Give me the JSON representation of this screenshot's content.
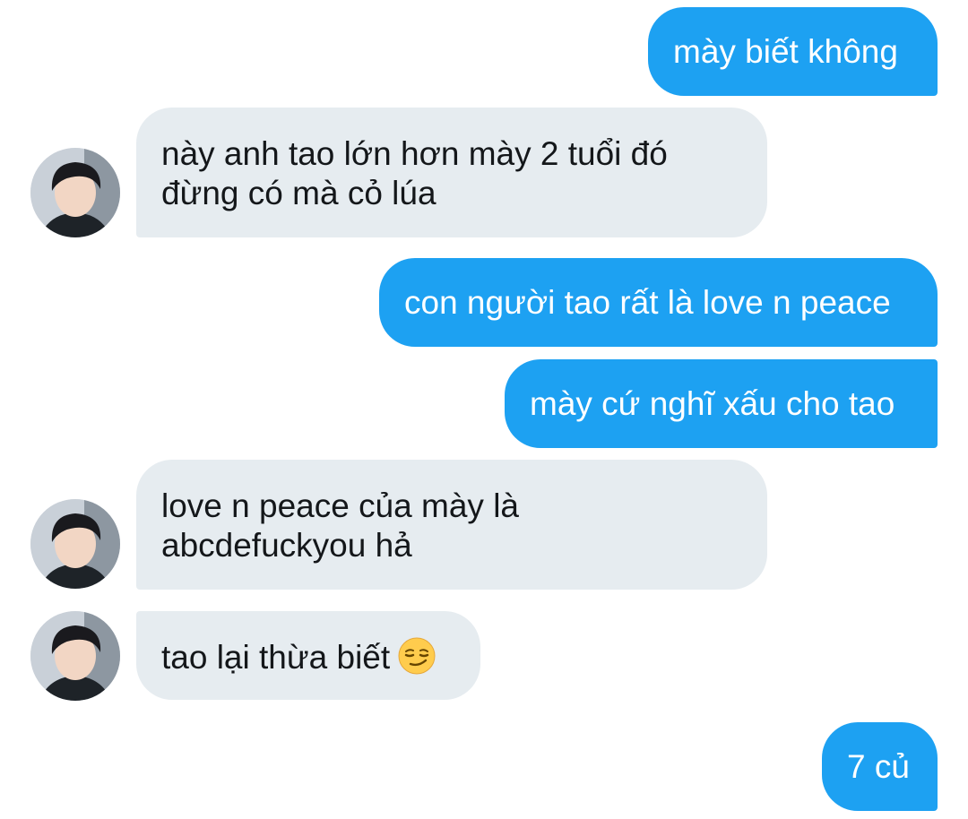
{
  "messages": [
    {
      "direction": "sent",
      "lines": [
        "mày biết không"
      ]
    },
    {
      "direction": "received",
      "lines": [
        "này anh tao lớn hơn mày 2 tuổi đó",
        "đừng có mà cỏ lúa"
      ]
    },
    {
      "direction": "sent",
      "lines": [
        "con người tao rất là love n peace"
      ]
    },
    {
      "direction": "sent",
      "lines": [
        "mày cứ nghĩ xấu cho tao"
      ]
    },
    {
      "direction": "received",
      "lines": [
        "love n peace của mày là",
        "abcdefuckyou hả"
      ]
    },
    {
      "direction": "received",
      "lines": [
        "tao lại thừa biết"
      ],
      "emoji": "smirking-face-icon"
    },
    {
      "direction": "sent",
      "lines": [
        "7 củ"
      ]
    }
  ],
  "colors": {
    "sent_bubble": "#1da1f2",
    "received_bubble": "#e6ecf0",
    "sent_text": "#ffffff",
    "received_text": "#14171a"
  }
}
